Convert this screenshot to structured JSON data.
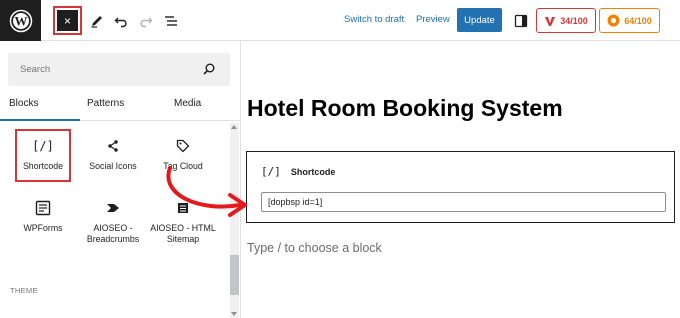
{
  "toolbar": {
    "close_label": "×",
    "switch_to_draft": "Switch to draft",
    "preview": "Preview",
    "update": "Update",
    "score_red": "34/100",
    "score_orange": "64/100"
  },
  "sidebar": {
    "search_placeholder": "Search",
    "tabs": [
      "Blocks",
      "Patterns",
      "Media"
    ],
    "blocks": [
      {
        "label": "Shortcode",
        "icon": "shortcode-icon"
      },
      {
        "label": "Social Icons",
        "icon": "share-icon"
      },
      {
        "label": "Tag Cloud",
        "icon": "tag-icon"
      },
      {
        "label": "WPForms",
        "icon": "wpforms-icon"
      },
      {
        "label": "AIOSEO - Breadcrumbs",
        "icon": "aioseo-arrow-icon"
      },
      {
        "label": "AIOSEO - HTML Sitemap",
        "icon": "sitemap-list-icon"
      }
    ],
    "section_label": "THEME"
  },
  "editor": {
    "title": "Hotel Room Booking System",
    "shortcode_block_label": "Shortcode",
    "shortcode_block_icon_text": "[/]",
    "shortcode_value": "[dopbsp id=1]",
    "placeholder": "Type / to choose a block"
  },
  "colors": {
    "accent": "#2271b1",
    "highlight_red": "#d63638",
    "score_orange": "#f18200",
    "dark": "#1e1e1e"
  }
}
